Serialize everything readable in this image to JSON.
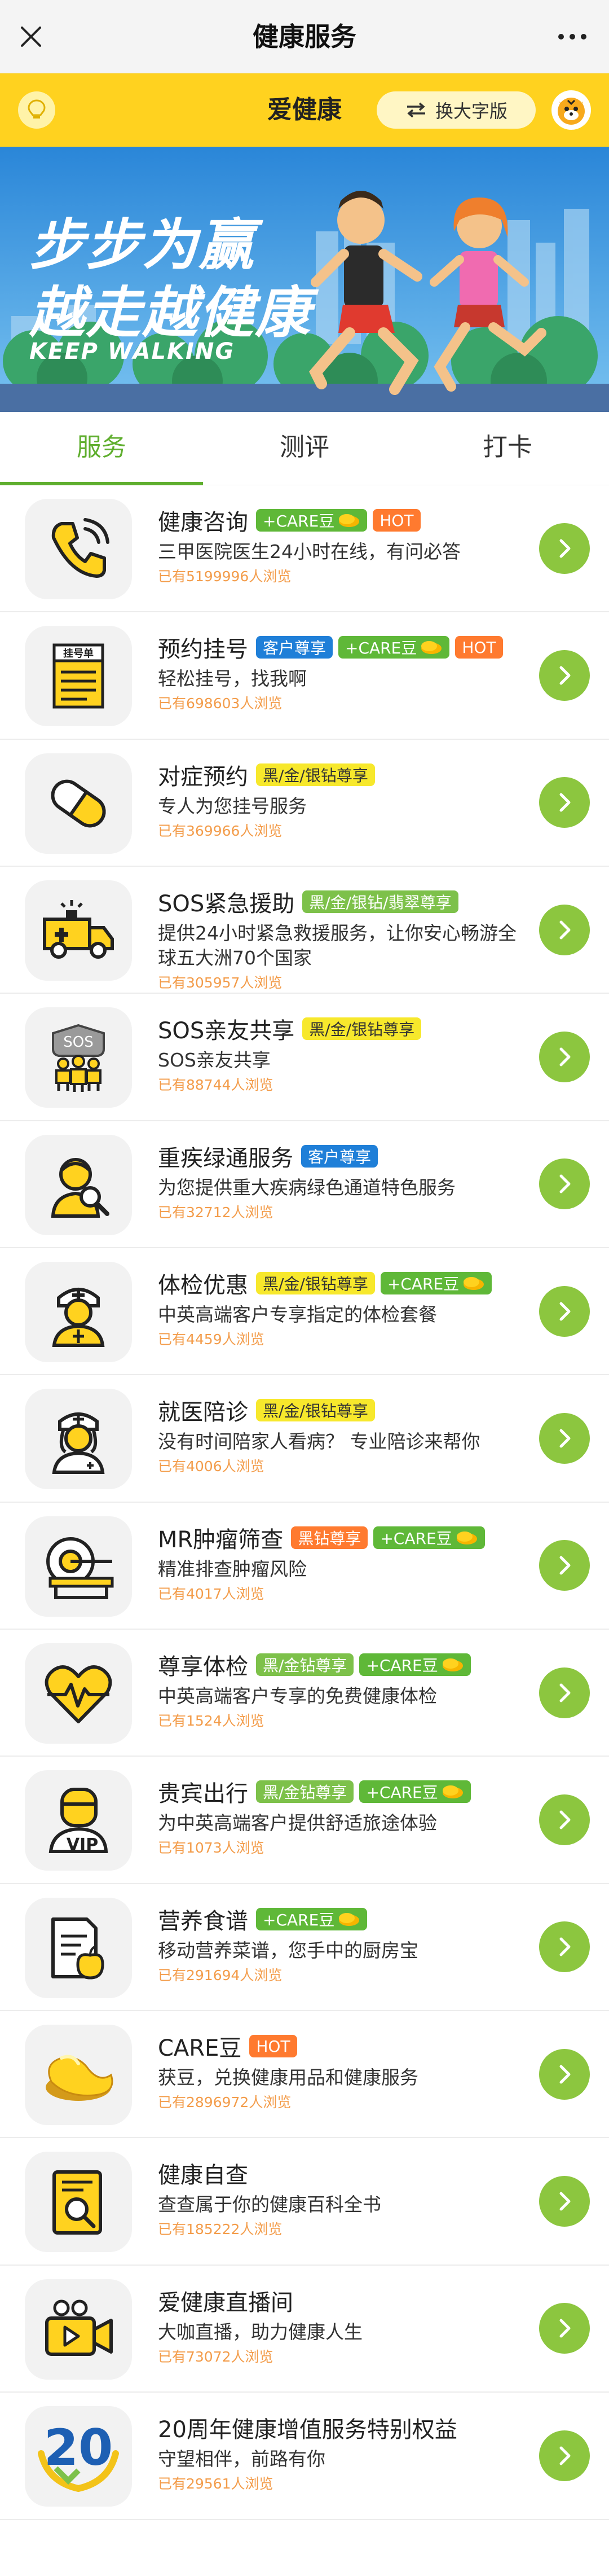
{
  "topnav": {
    "title": "健康服务"
  },
  "header": {
    "title": "爱健康",
    "font_switch_label": "换大字版"
  },
  "banner": {
    "line1": "步步为赢",
    "line2": "越走越健康",
    "line3": "KEEP WALKING"
  },
  "tabs": [
    {
      "label": "服务",
      "active": true
    },
    {
      "label": "测评",
      "active": false
    },
    {
      "label": "打卡",
      "active": false
    }
  ],
  "colors": {
    "accent": "#5fae2e",
    "brand_yellow": "#ffd21f",
    "arrow_green": "#8cc63f",
    "views_orange": "#f39c4a",
    "hot": "#ff7a2f",
    "customer_blue": "#1f7fd8",
    "tier_yellow": "#f7e82c",
    "care_green": "#5fb838"
  },
  "badge_types": {
    "care": {
      "text": "+CARE豆",
      "bg": "#5fb838",
      "fg": "#ffffff"
    },
    "hot": {
      "text": "HOT",
      "bg": "#ff7a2f",
      "fg": "#ffffff"
    },
    "customer": {
      "text": "客户尊享",
      "bg": "#1f7fd8",
      "fg": "#ffffff"
    },
    "tier_bgs": {
      "text": "黑/金/银钻尊享",
      "bg": "#f7e82c",
      "fg": "#333333"
    },
    "tier_bgsf": {
      "text": "黑/金/银钻/翡翠尊享",
      "bg": "#7dc14a",
      "fg": "#ffffff"
    },
    "black_vip": {
      "text": "黑钻尊享",
      "bg": "#ff7a2f",
      "fg": "#ffffff"
    },
    "tier_bg": {
      "text": "黑/金钻尊享",
      "bg": "#7dc14a",
      "fg": "#ffffff"
    }
  },
  "services": [
    {
      "icon": "phone-icon",
      "title": "健康咨询",
      "badges": [
        "care",
        "hot"
      ],
      "desc": "三甲医院医生24小时在线，有问必答",
      "views": "已有5199996人浏览"
    },
    {
      "icon": "register-form-icon",
      "title": "预约挂号",
      "badges": [
        "customer",
        "care",
        "hot"
      ],
      "desc": "轻松挂号，找我啊",
      "views": "已有698603人浏览",
      "icon_text": "挂号单"
    },
    {
      "icon": "pill-icon",
      "title": "对症预约",
      "badges": [
        "tier_bgs"
      ],
      "desc": "专人为您挂号服务",
      "views": "已有369966人浏览"
    },
    {
      "icon": "ambulance-icon",
      "title": "SOS紧急援助",
      "badges": [
        "tier_bgsf"
      ],
      "desc": "提供24小时紧急救援服务，让你安心畅游全球五大洲70个国家",
      "views": "已有305957人浏览"
    },
    {
      "icon": "sos-family-icon",
      "title": "SOS亲友共享",
      "badges": [
        "tier_bgs"
      ],
      "desc": "SOS亲友共享",
      "views": "已有88744人浏览",
      "icon_text": "SOS"
    },
    {
      "icon": "doctor-search-icon",
      "title": "重疾绿通服务",
      "badges": [
        "customer"
      ],
      "desc": "为您提供重大疾病绿色通道特色服务",
      "views": "已有32712人浏览"
    },
    {
      "icon": "nurse-icon",
      "title": "体检优惠",
      "badges": [
        "tier_bgs",
        "care"
      ],
      "desc": "中英高端客户专享指定的体检套餐",
      "views": "已有4459人浏览"
    },
    {
      "icon": "female-nurse-icon",
      "title": "就医陪诊",
      "badges": [
        "tier_bgs"
      ],
      "desc": "没有时间陪家人看病？ 专业陪诊来帮你",
      "views": "已有4006人浏览"
    },
    {
      "icon": "mri-scanner-icon",
      "title": "MR肿瘤筛查",
      "badges": [
        "black_vip",
        "care"
      ],
      "desc": "精准排查肿瘤风险",
      "views": "已有4017人浏览"
    },
    {
      "icon": "heart-pulse-icon",
      "title": "尊享体检",
      "badges": [
        "tier_bg",
        "care"
      ],
      "desc": "中英高端客户专享的免费健康体检",
      "views": "已有1524人浏览"
    },
    {
      "icon": "vip-person-icon",
      "title": "贵宾出行",
      "badges": [
        "tier_bg",
        "care"
      ],
      "desc": "为中英高端客户提供舒适旅途体验",
      "views": "已有1073人浏览",
      "icon_text": "VIP"
    },
    {
      "icon": "recipe-apple-icon",
      "title": "营养食谱",
      "badges": [
        "care"
      ],
      "desc": "移动营养菜谱，您手中的厨房宝",
      "views": "已有291694人浏览"
    },
    {
      "icon": "care-bean-icon",
      "title": "CARE豆",
      "badges": [
        "hot"
      ],
      "desc": "获豆，兑换健康用品和健康服务",
      "views": "已有2896972人浏览"
    },
    {
      "icon": "health-book-icon",
      "title": "健康自查",
      "badges": [],
      "desc": "查查属于你的健康百科全书",
      "views": "已有185222人浏览"
    },
    {
      "icon": "video-camera-icon",
      "title": "爱健康直播间",
      "badges": [],
      "desc": "大咖直播，助力健康人生",
      "views": "已有73072人浏览"
    },
    {
      "icon": "anniversary-20-icon",
      "title": "20周年健康增值服务特别权益",
      "badges": [],
      "desc": "守望相伴，前路有你",
      "views": "已有29561人浏览",
      "icon_text": "20"
    }
  ]
}
